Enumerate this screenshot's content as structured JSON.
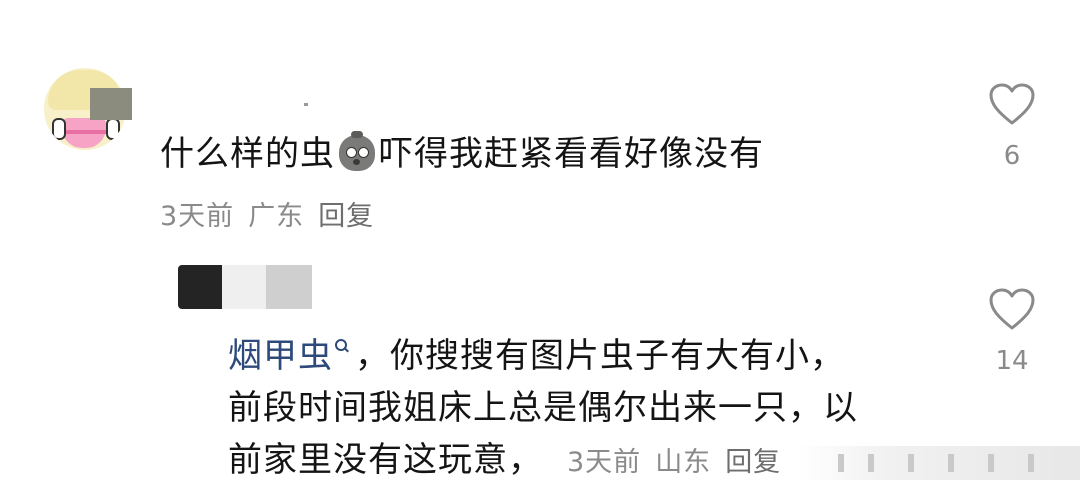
{
  "comment": {
    "text_before_emoji": "什么样的虫",
    "emoji": "bag-face-emoji",
    "text_after_emoji": "吓得我赶紧看看好像没有",
    "time": "3天前",
    "location": "广东",
    "reply_label": "回复",
    "likes": "6"
  },
  "reply": {
    "keyword": "烟甲虫",
    "line1_rest": "，你搜搜有图片虫子有大有小，",
    "line2": "前段时间我姐床上总是偶尔出来一只，以",
    "line3": "前家里没有这玩意，",
    "time": "3天前",
    "location": "山东",
    "reply_label": "回复",
    "likes": "14"
  },
  "colors": {
    "text": "#141414",
    "meta": "#8a8a8a",
    "link": "#2d4a7a"
  }
}
